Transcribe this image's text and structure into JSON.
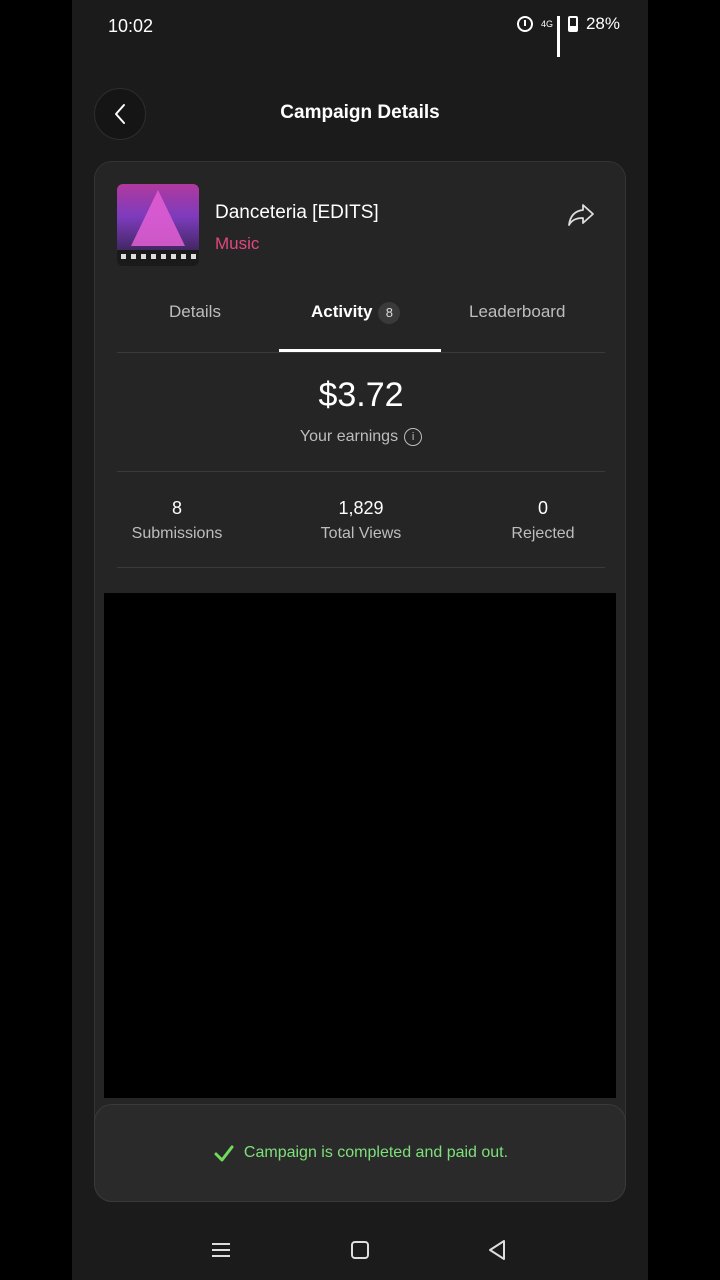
{
  "status": {
    "time": "10:02",
    "network": "4G",
    "battery": "28%"
  },
  "header": {
    "title": "Campaign Details"
  },
  "campaign": {
    "title": "Danceteria [EDITS]",
    "category": "Music",
    "category_color": "#e0487f"
  },
  "tabs": [
    {
      "label": "Details"
    },
    {
      "label": "Activity",
      "badge": "8",
      "active": true
    },
    {
      "label": "Leaderboard"
    }
  ],
  "earnings": {
    "amount": "$3.72",
    "label": "Your earnings"
  },
  "stats": [
    {
      "value": "8",
      "label": "Submissions"
    },
    {
      "value": "1,829",
      "label": "Total Views"
    },
    {
      "value": "0",
      "label": "Rejected"
    }
  ],
  "notice": {
    "text": "Campaign is completed and paid out.",
    "color": "#7ee07a"
  },
  "icons": {
    "back": "chevron-left-icon",
    "share": "share-arrow-icon",
    "info": "info-icon",
    "check": "check-icon",
    "nav_recents": "menu-icon",
    "nav_home": "square-icon",
    "nav_back": "triangle-back-icon"
  }
}
